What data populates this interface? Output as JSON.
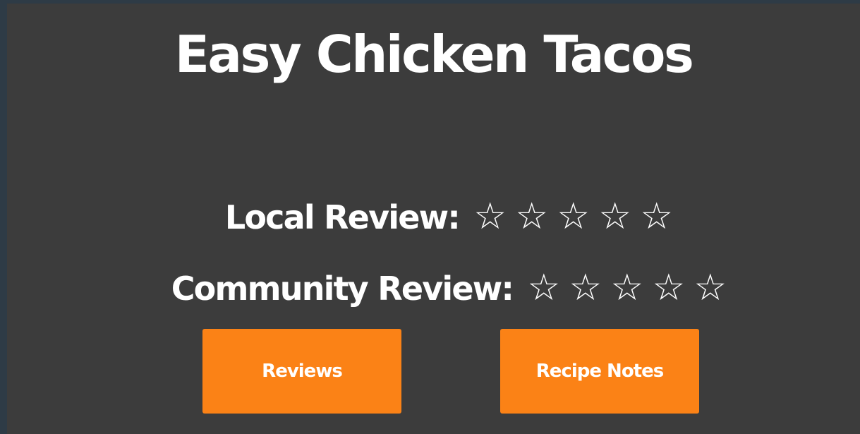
{
  "recipe": {
    "title": "Easy Chicken Tacos"
  },
  "ratings": {
    "local_label": "Local Review:",
    "local_stars": 0,
    "community_label": "Community Review:",
    "community_stars": 0,
    "max_stars": 5,
    "star_glyph": "☆"
  },
  "buttons": {
    "reviews_label": "Reviews",
    "notes_label": "Recipe Notes"
  },
  "colors": {
    "background": "#3c3c3c",
    "frame": "#2e3b46",
    "accent": "#fb8216",
    "text": "#ffffff"
  }
}
